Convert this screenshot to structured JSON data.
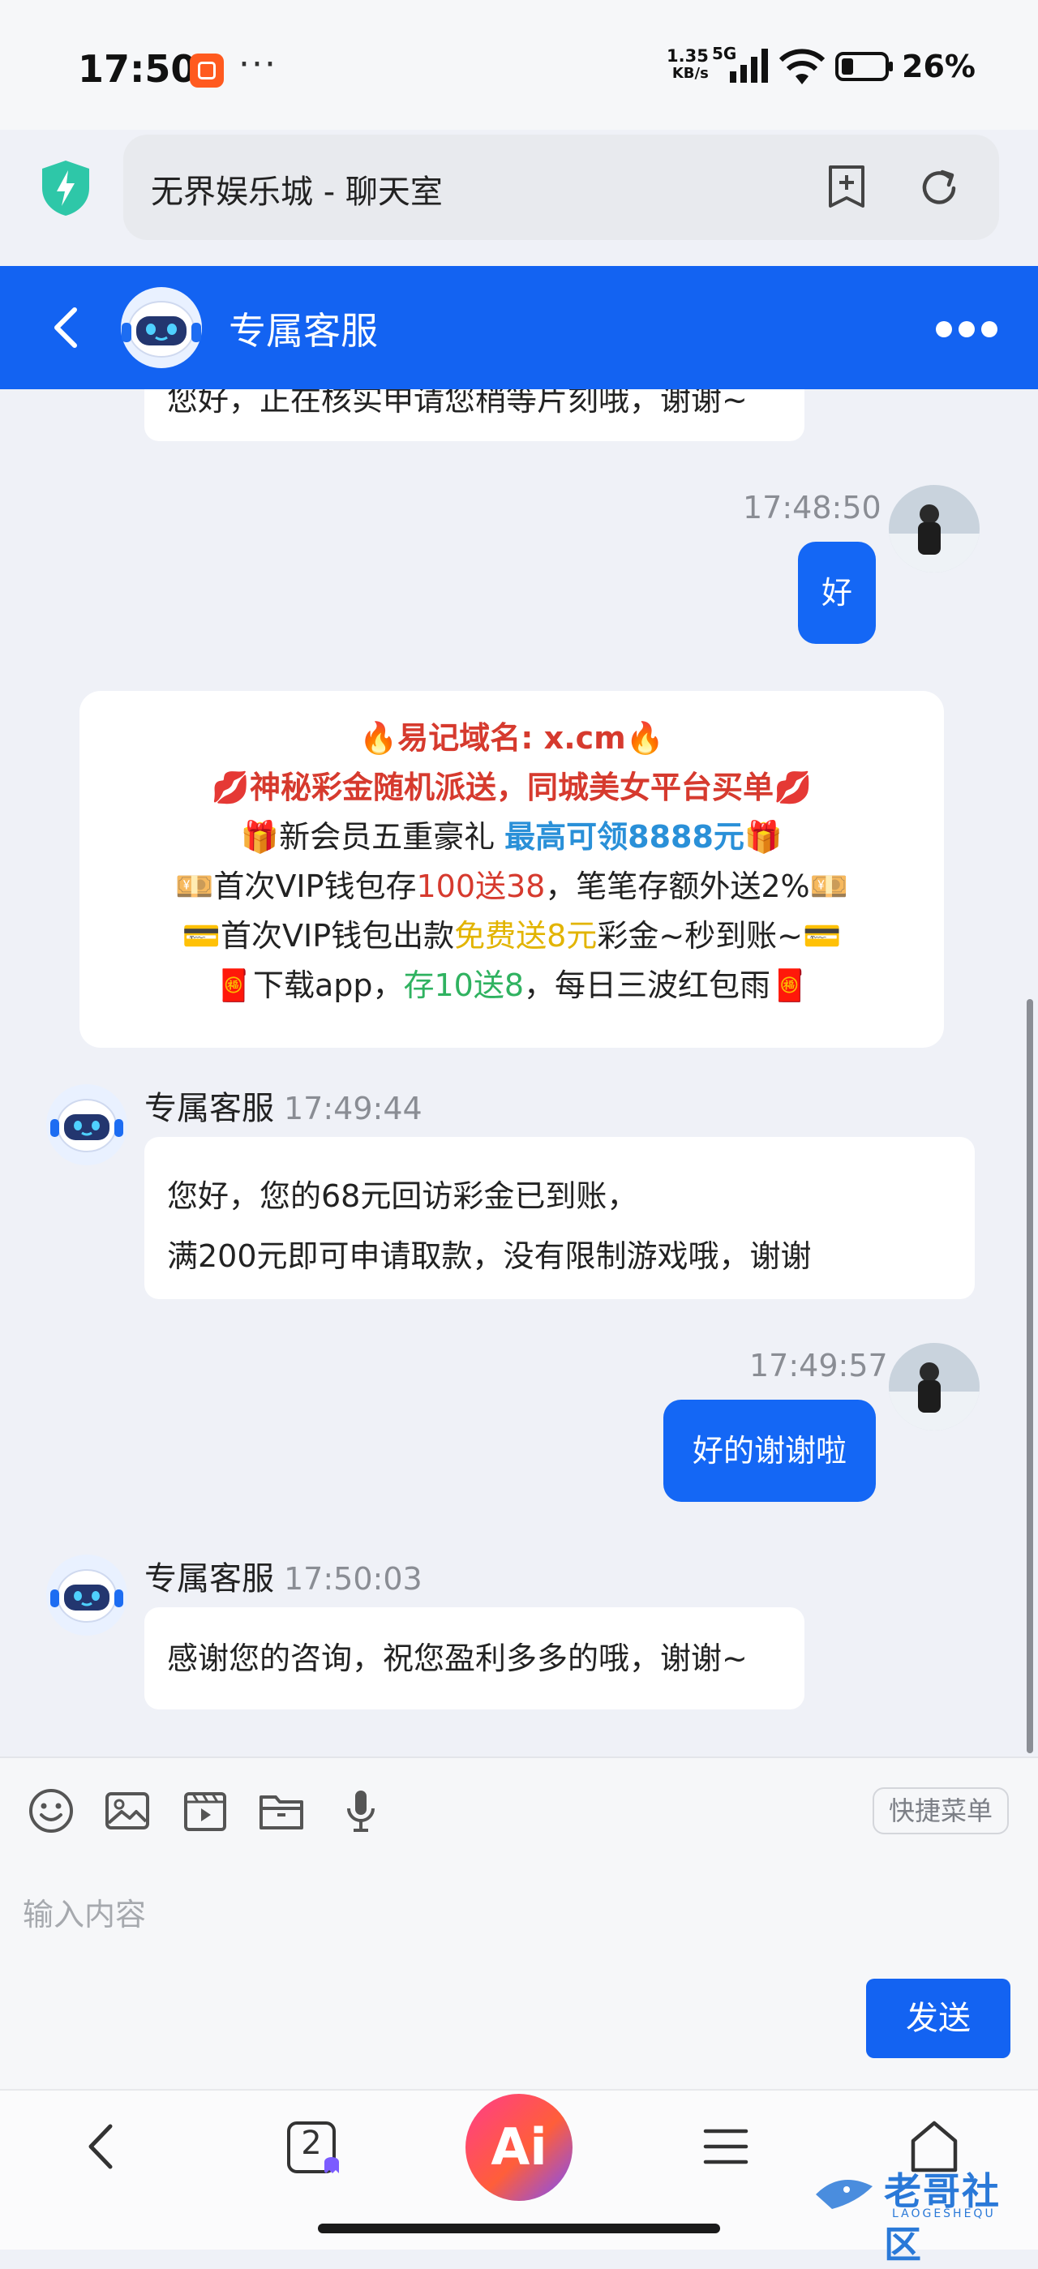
{
  "status_bar": {
    "time": "17:50",
    "more": "···",
    "net_speed_value": "1.35",
    "net_speed_unit": "KB/s",
    "network": "5G",
    "battery": "26%"
  },
  "browser": {
    "page_title": "无界娱乐城 - 聊天室"
  },
  "chat_header": {
    "title": "专属客服"
  },
  "messages": {
    "partial_text": "您好，正在核实申请您稍等片刻哦，谢谢~",
    "msg1_time": "17:48:50",
    "msg1_text": "好",
    "promo": {
      "l1_a": "🔥易记域名: x.cm🔥",
      "l2_a": "💋神秘彩金随机派送，同城美女平台买单💋",
      "l3_a": "🎁新会员五重豪礼 ",
      "l3_b": "最高可领8888元",
      "l3_c": "🎁",
      "l4_a": "💴首次VIP钱包存",
      "l4_b": "100送38",
      "l4_c": "，笔笔存额外送2%💴",
      "l5_a": "💳首次VIP钱包出款",
      "l5_b": "免费送8元",
      "l5_c": "彩金~秒到账~💳",
      "l6_a": "🧧下载app，",
      "l6_b": "存10送8",
      "l6_c": "，每日三波红包雨🧧"
    },
    "msg2_sender": "专属客服",
    "msg2_time": "17:49:44",
    "msg2_line1": "您好，您的68元回访彩金已到账，",
    "msg2_line2": "满200元即可申请取款，没有限制游戏哦，谢谢",
    "msg3_time": "17:49:57",
    "msg3_text": "好的谢谢啦",
    "msg4_sender": "专属客服",
    "msg4_time": "17:50:03",
    "msg4_text": "感谢您的咨询，祝您盈利多多的哦，谢谢~"
  },
  "composer": {
    "quick_menu": "快捷菜单",
    "placeholder": "输入内容",
    "send": "发送"
  },
  "bottom_nav": {
    "tabs_count": "2",
    "ai_label": "Ai",
    "watermark": "老哥社区",
    "watermark_sub": "LAOGESHEQU"
  },
  "colors": {
    "primary": "#1363f2",
    "background": "#eff1f7",
    "promo_red": "#d63a2e",
    "promo_blue": "#2a90d8",
    "promo_yellow": "#e2b400",
    "promo_green": "#2fb260"
  }
}
